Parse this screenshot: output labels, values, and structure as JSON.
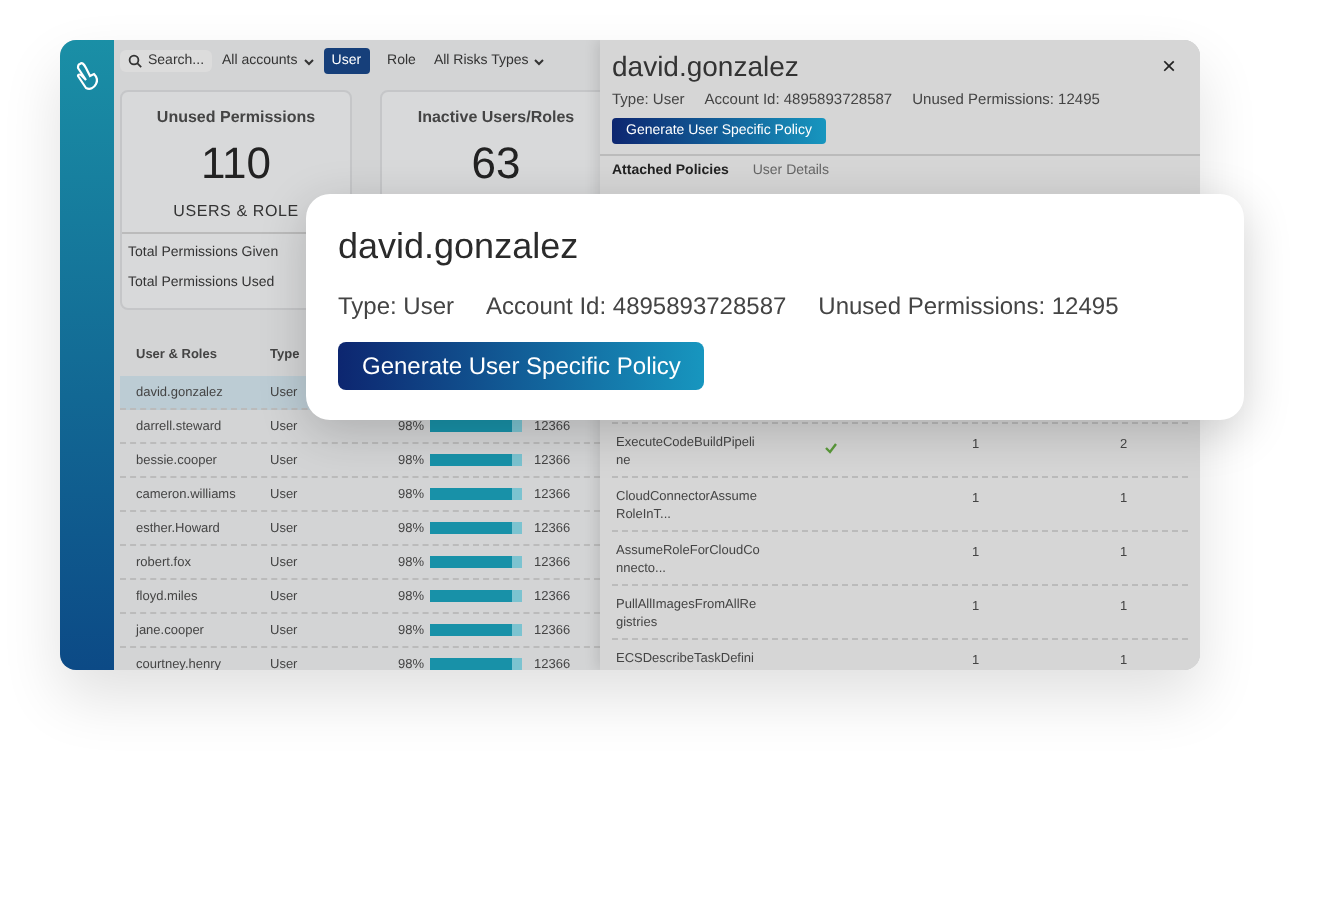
{
  "toolbar": {
    "search": {
      "placeholder": "Search..."
    },
    "account_filter": "All accounts",
    "type_toggle": [
      {
        "label": "User",
        "selected": true
      },
      {
        "label": "Role",
        "selected": false
      }
    ],
    "risk_filter": "All Risks Types"
  },
  "stats": [
    {
      "title": "Unused Permissions",
      "value": "110",
      "caption": "USERS & ROLE",
      "lines": [
        "Total Permissions Given",
        "Total Permissions Used"
      ]
    },
    {
      "title": "Inactive Users/Roles",
      "value": "63"
    }
  ],
  "users_table": {
    "columns": [
      "User & Roles",
      "Type"
    ],
    "rows": [
      {
        "name": "david.gonzalez",
        "type": "User",
        "selected": true
      },
      {
        "name": "darrell.steward",
        "type": "User",
        "percent": "98%",
        "level": 0.9,
        "count": "12366",
        "selected": false
      },
      {
        "name": "bessie.cooper",
        "type": "User",
        "percent": "98%",
        "level": 0.9,
        "count": "12366",
        "selected": false
      },
      {
        "name": "cameron.williams",
        "type": "User",
        "percent": "98%",
        "level": 0.9,
        "count": "12366",
        "selected": false
      },
      {
        "name": "esther.Howard",
        "type": "User",
        "percent": "98%",
        "level": 0.9,
        "count": "12366",
        "selected": false
      },
      {
        "name": "robert.fox",
        "type": "User",
        "percent": "98%",
        "level": 0.9,
        "count": "12366",
        "selected": false
      },
      {
        "name": "floyd.miles",
        "type": "User",
        "percent": "98%",
        "level": 0.9,
        "count": "12366",
        "selected": false
      },
      {
        "name": "jane.cooper",
        "type": "User",
        "percent": "98%",
        "level": 0.9,
        "count": "12366",
        "selected": false
      },
      {
        "name": "courtney.henry",
        "type": "User",
        "percent": "98%",
        "level": 0.9,
        "count": "12366",
        "selected": false
      }
    ]
  },
  "detail_panel": {
    "title": "david.gonzalez",
    "type": "Type: User",
    "account": "Account Id: 4895893728587",
    "unused": "Unused Permissions: 12495",
    "button": "Generate User Specific Policy",
    "close": "×",
    "tabs": [
      {
        "label": "Attached Policies",
        "selected": true
      },
      {
        "label": "User Details",
        "selected": false
      }
    ],
    "policies": [
      {
        "name": "ExecuteCodeBuildPipeline",
        "checked": true,
        "column_3": "1",
        "column_4": "2"
      },
      {
        "name": "CloudConnectorAssumeRoleInT...",
        "checked": false,
        "column_3": "1",
        "column_4": "1"
      },
      {
        "name": "AssumeRoleForCloudConnecto...",
        "checked": false,
        "column_3": "1",
        "column_4": "1"
      },
      {
        "name": "PullAllImagesFromAllRegistries",
        "checked": false,
        "column_3": "1",
        "column_4": "1"
      },
      {
        "name": "ECSDescribeTaskDefini",
        "checked": false,
        "column_3": "1",
        "column_4": "1"
      }
    ]
  },
  "popup": {
    "title": "david.gonzalez",
    "type": "Type: User",
    "account": "Account Id: 4895893728587",
    "unused": "Unused Permissions: 12495",
    "button": "Generate User Specific Policy"
  }
}
